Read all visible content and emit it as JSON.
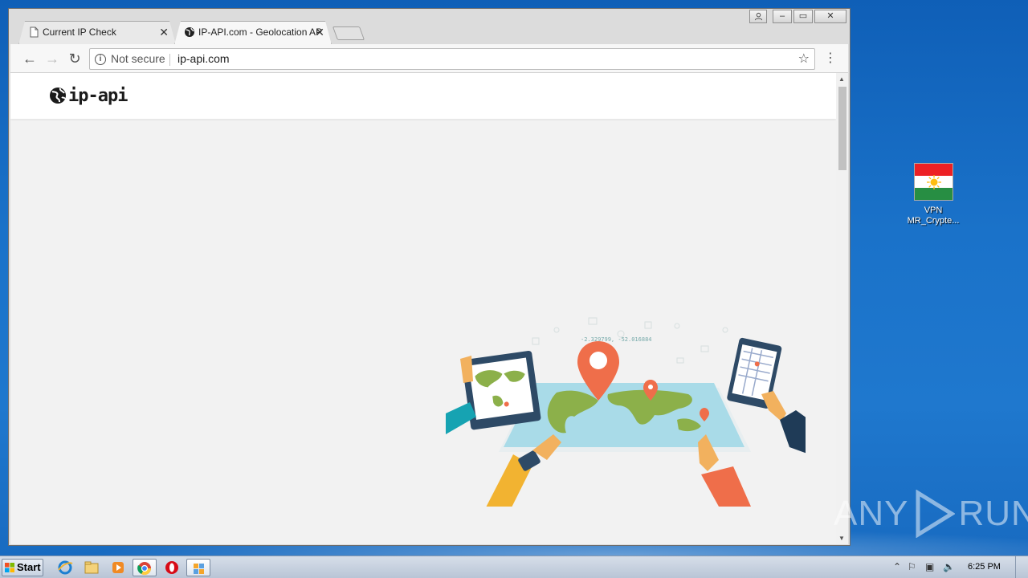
{
  "browser": {
    "tabs": [
      {
        "title": "Current IP Check",
        "active": false
      },
      {
        "title": "IP-API.com - Geolocation AP",
        "active": true
      }
    ],
    "omnibox": {
      "security_label": "Not secure",
      "url": "ip-api.com"
    }
  },
  "site": {
    "logo_text": "ip-api",
    "illustration_caption": "-2.329799, -52.016884"
  },
  "desktop": {
    "icon": {
      "label_line1": "VPN",
      "label_line2": "MR_Crypte..."
    },
    "watermark": {
      "left": "ANY",
      "right": "RUN"
    }
  },
  "taskbar": {
    "start_label": "Start",
    "clock": "6:25 PM"
  },
  "colors": {
    "desktop": "#1a72c9",
    "pin": "#ef6e4a",
    "map_land": "#8cb04a",
    "map_water": "#a9dbe8"
  }
}
